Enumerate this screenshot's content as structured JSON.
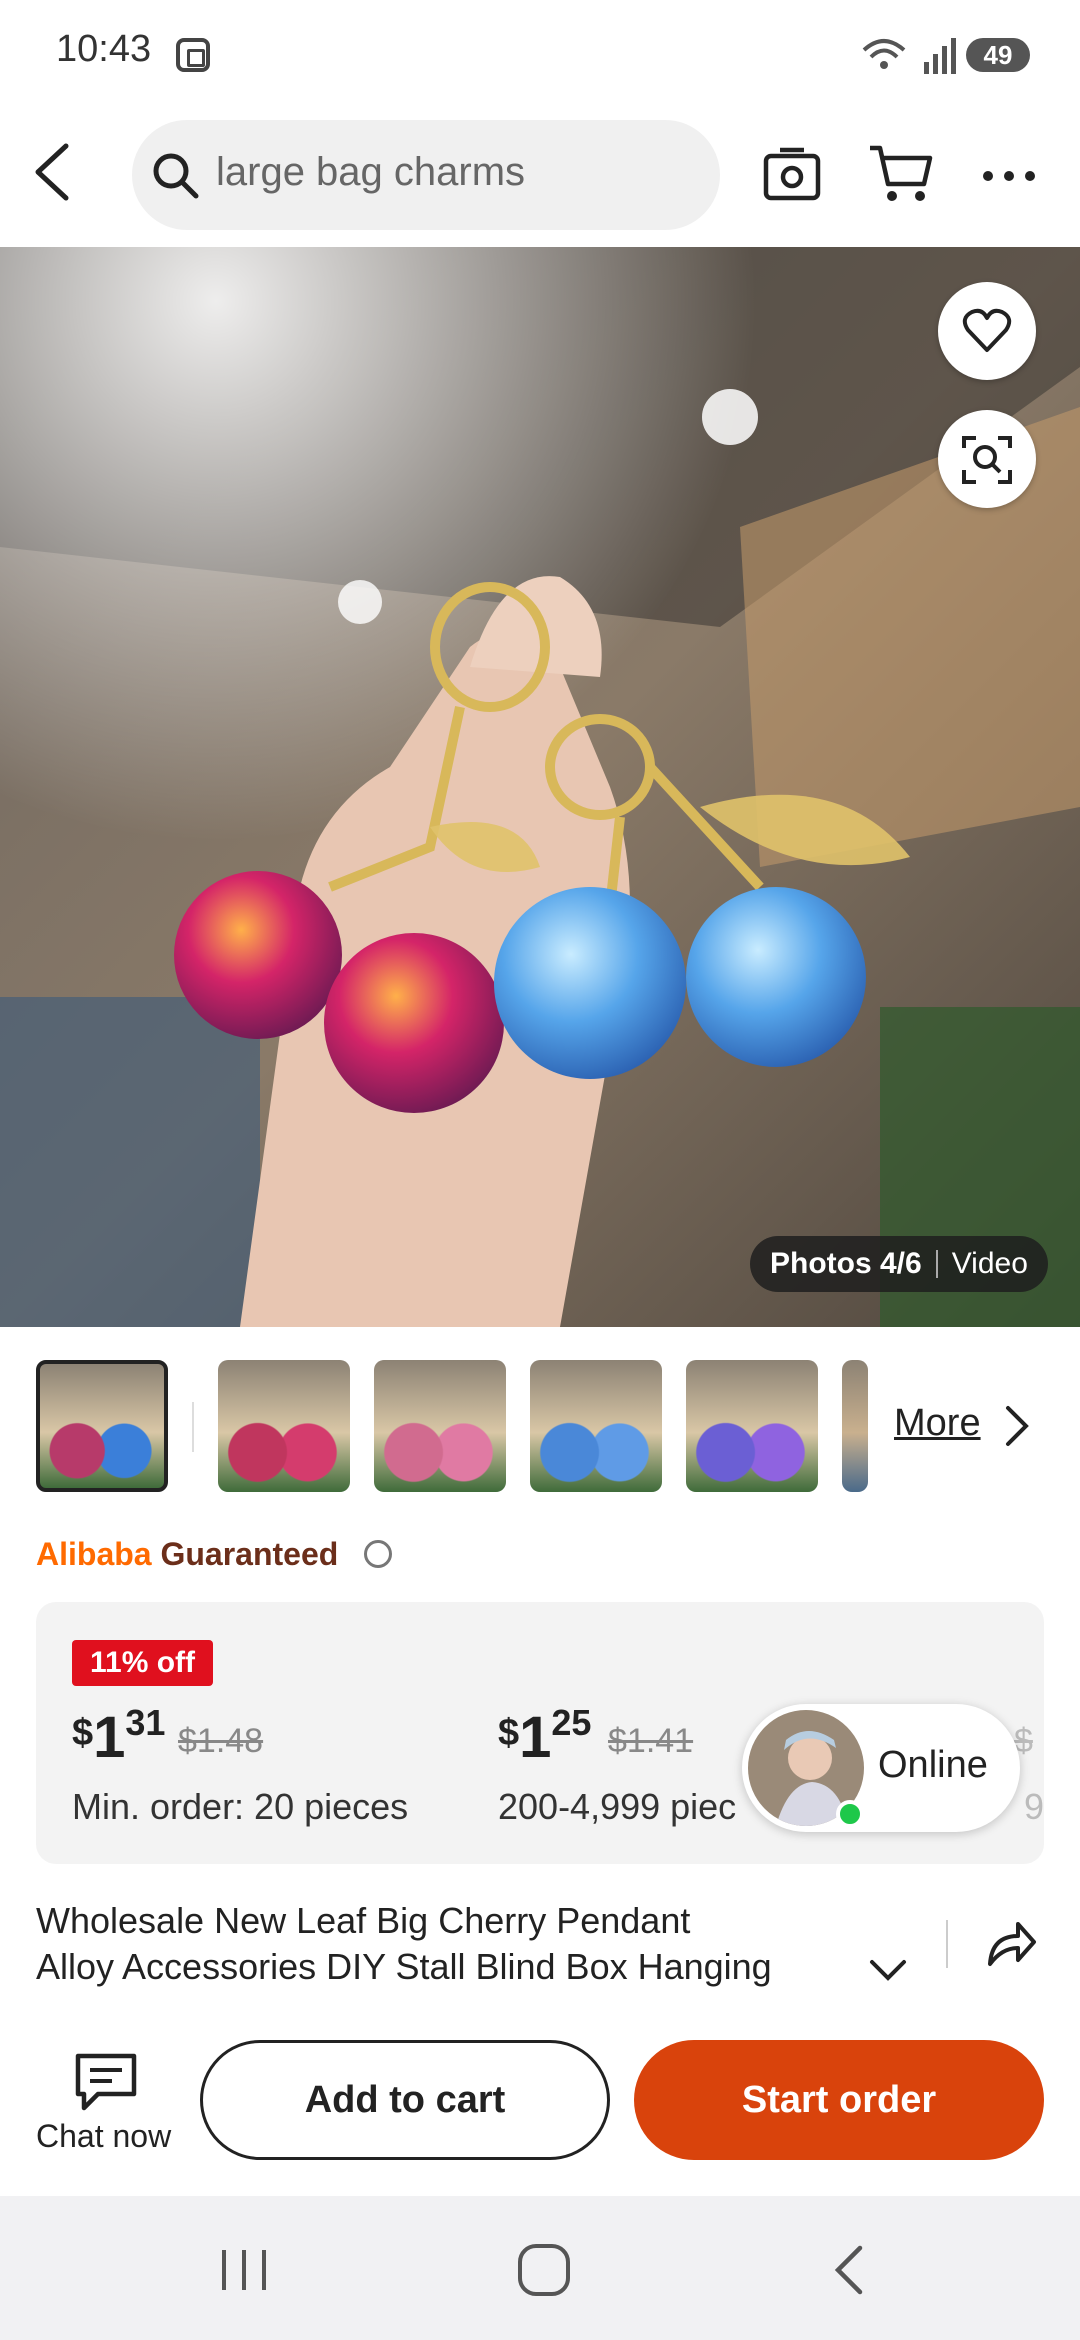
{
  "status_bar": {
    "time": "10:43",
    "battery": "49"
  },
  "header": {
    "search_text": "large bag charms",
    "icons": [
      "back-arrow-icon",
      "search-icon",
      "camera-icon",
      "cart-icon",
      "more-icon"
    ]
  },
  "hero": {
    "photos_label": "Photos 4/6",
    "video_label": "Video",
    "icons": [
      "heart-icon",
      "visual-search-icon"
    ]
  },
  "thumbnails": {
    "items": [
      {
        "colors": [
          "#b73a6a",
          "#3b7fd9"
        ]
      },
      {
        "colors": [
          "#c0365e",
          "#d43c6d"
        ]
      },
      {
        "colors": [
          "#d16b8f",
          "#e07aa3"
        ]
      },
      {
        "colors": [
          "#4a88d8",
          "#5f9be6"
        ]
      },
      {
        "colors": [
          "#6b5fd4",
          "#8f63e0"
        ]
      }
    ],
    "more_label": "More"
  },
  "guarantee": {
    "brand": "Alibaba",
    "label": "Guaranteed"
  },
  "pricing": {
    "discount_badge": "11% off",
    "tiers": [
      {
        "currency": "$",
        "dollars": "1",
        "cents": "31",
        "old_price": "$1.48",
        "min_order": "Min. order: 20 pieces"
      },
      {
        "currency": "$",
        "dollars": "1",
        "cents": "25",
        "old_price": "$1.41",
        "min_order": "200-4,999 piec"
      },
      {
        "currency": "",
        "dollars": "",
        "cents": "",
        "old_price": "$",
        "min_order": "9"
      }
    ]
  },
  "online": {
    "label": "Online"
  },
  "product": {
    "title_line1": "Wholesale New Leaf Big Cherry Pendant",
    "title_line2": "Alloy Accessories DIY Stall Blind Box Hanging"
  },
  "actions": {
    "chat_label": "Chat now",
    "add_to_cart": "Add to cart",
    "start_order": "Start order"
  },
  "colors": {
    "accent": "#d9430c",
    "discount": "#e0101e",
    "online": "#1ec84a"
  }
}
